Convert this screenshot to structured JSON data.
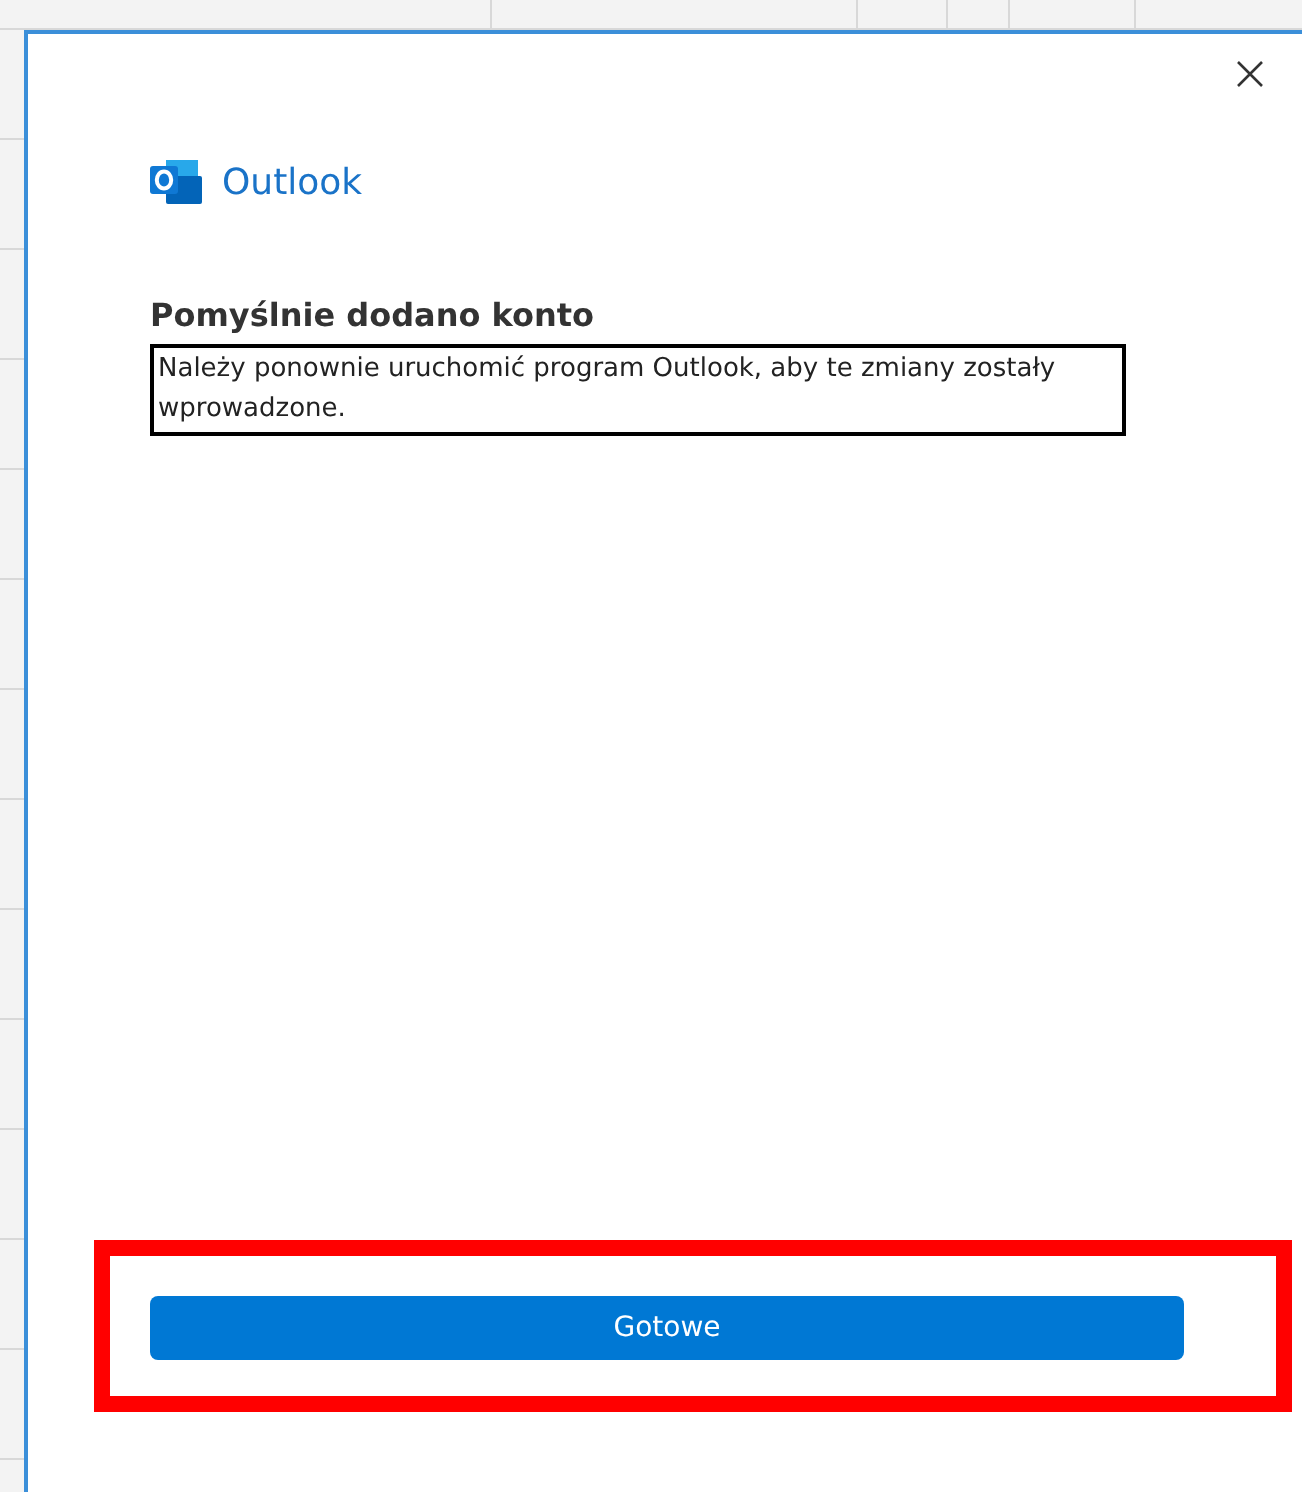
{
  "dialog": {
    "brand": "Outlook",
    "heading": "Pomyślnie dodano konto",
    "message": "Należy ponownie uruchomić program Outlook, aby te zmiany zostały wprowadzone.",
    "button": {
      "label": "Gotowe",
      "highlighted": true
    }
  }
}
